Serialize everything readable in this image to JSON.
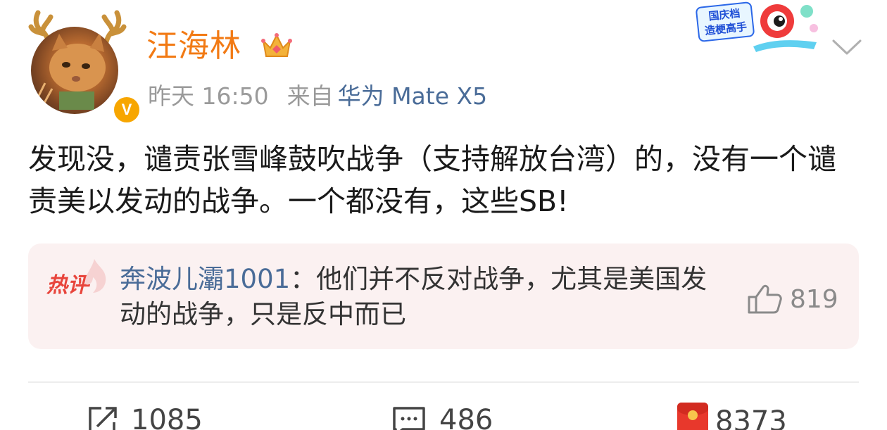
{
  "post": {
    "author": "汪海林",
    "time": "昨天 16:50",
    "from_label": "来自",
    "source": "华为 Mate X5",
    "text": "发现没，谴责张雪峰鼓吹战争（支持解放台湾）的，没有一个谴责美以发动的战争。一个都没有，这些SB!",
    "badge_text": "国庆档\n造梗高手"
  },
  "hot_comment": {
    "tag": "热评",
    "user": "奔波儿灞1001",
    "separator": "：",
    "text": "他们并不反对战争，尤其是美国发动的战争，只是反中而已",
    "likes": "819"
  },
  "actions": {
    "reposts": "1085",
    "comments": "486",
    "likes": "8373"
  },
  "colors": {
    "username": "#f27a14",
    "link": "#4a6c98",
    "hot_tag": "#e8453c",
    "comment_bg": "#fbf1f1"
  },
  "icons": {
    "verified": "verified-v-icon",
    "crown": "crown-icon",
    "menu": "chevron-down-icon",
    "repost": "repost-icon",
    "comment": "comment-icon",
    "like": "thumbs-up-icon",
    "redpacket": "red-packet-icon"
  }
}
